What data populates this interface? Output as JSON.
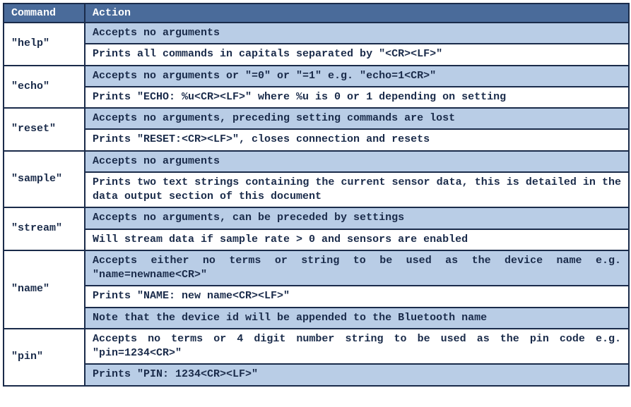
{
  "header": {
    "command": "Command",
    "action": "Action"
  },
  "rows": [
    {
      "command": "\"help\"",
      "actions": [
        {
          "text": "Accepts no arguments",
          "bg": "blue"
        },
        {
          "text": "Prints all commands in capitals separated by \"<CR><LF>\"",
          "bg": "white"
        }
      ]
    },
    {
      "command": "\"echo\"",
      "actions": [
        {
          "text": "Accepts no arguments or \"=0\" or \"=1\" e.g. \"echo=1<CR>\"",
          "bg": "blue"
        },
        {
          "text": "Prints \"ECHO: %u<CR><LF>\" where %u is 0 or 1 depending on setting",
          "bg": "white"
        }
      ]
    },
    {
      "command": "\"reset\"",
      "actions": [
        {
          "text": "Accepts no arguments, preceding setting commands are lost",
          "bg": "blue"
        },
        {
          "text": "Prints \"RESET:<CR><LF>\", closes connection and resets",
          "bg": "white"
        }
      ]
    },
    {
      "command": "\"sample\"",
      "actions": [
        {
          "text": "Accepts no arguments",
          "bg": "blue"
        },
        {
          "text": "Prints two text strings containing the current sensor data, this is detailed in the data output section of this document",
          "bg": "white",
          "justify": true
        }
      ]
    },
    {
      "command": "\"stream\"",
      "actions": [
        {
          "text": "Accepts no arguments, can be preceded by settings",
          "bg": "blue"
        },
        {
          "text": "Will stream data if sample rate > 0 and sensors are enabled",
          "bg": "white"
        }
      ]
    },
    {
      "command": "\"name\"",
      "actions": [
        {
          "text": "Accepts either no terms or string to be used as the device name e.g. \"name=newname<CR>\"",
          "bg": "blue",
          "justify": true
        },
        {
          "text": "Prints \"NAME: new name<CR><LF>\"",
          "bg": "white"
        },
        {
          "text": "Note that the device id will be appended to the Bluetooth name",
          "bg": "blue"
        }
      ]
    },
    {
      "command": "\"pin\"",
      "actions": [
        {
          "text": "Accepts no terms or 4 digit number string to be used as the pin code e.g. \"pin=1234<CR>\"",
          "bg": "white",
          "justify": true
        },
        {
          "text": "Prints \"PIN: 1234<CR><LF>\"",
          "bg": "blue"
        }
      ]
    }
  ]
}
